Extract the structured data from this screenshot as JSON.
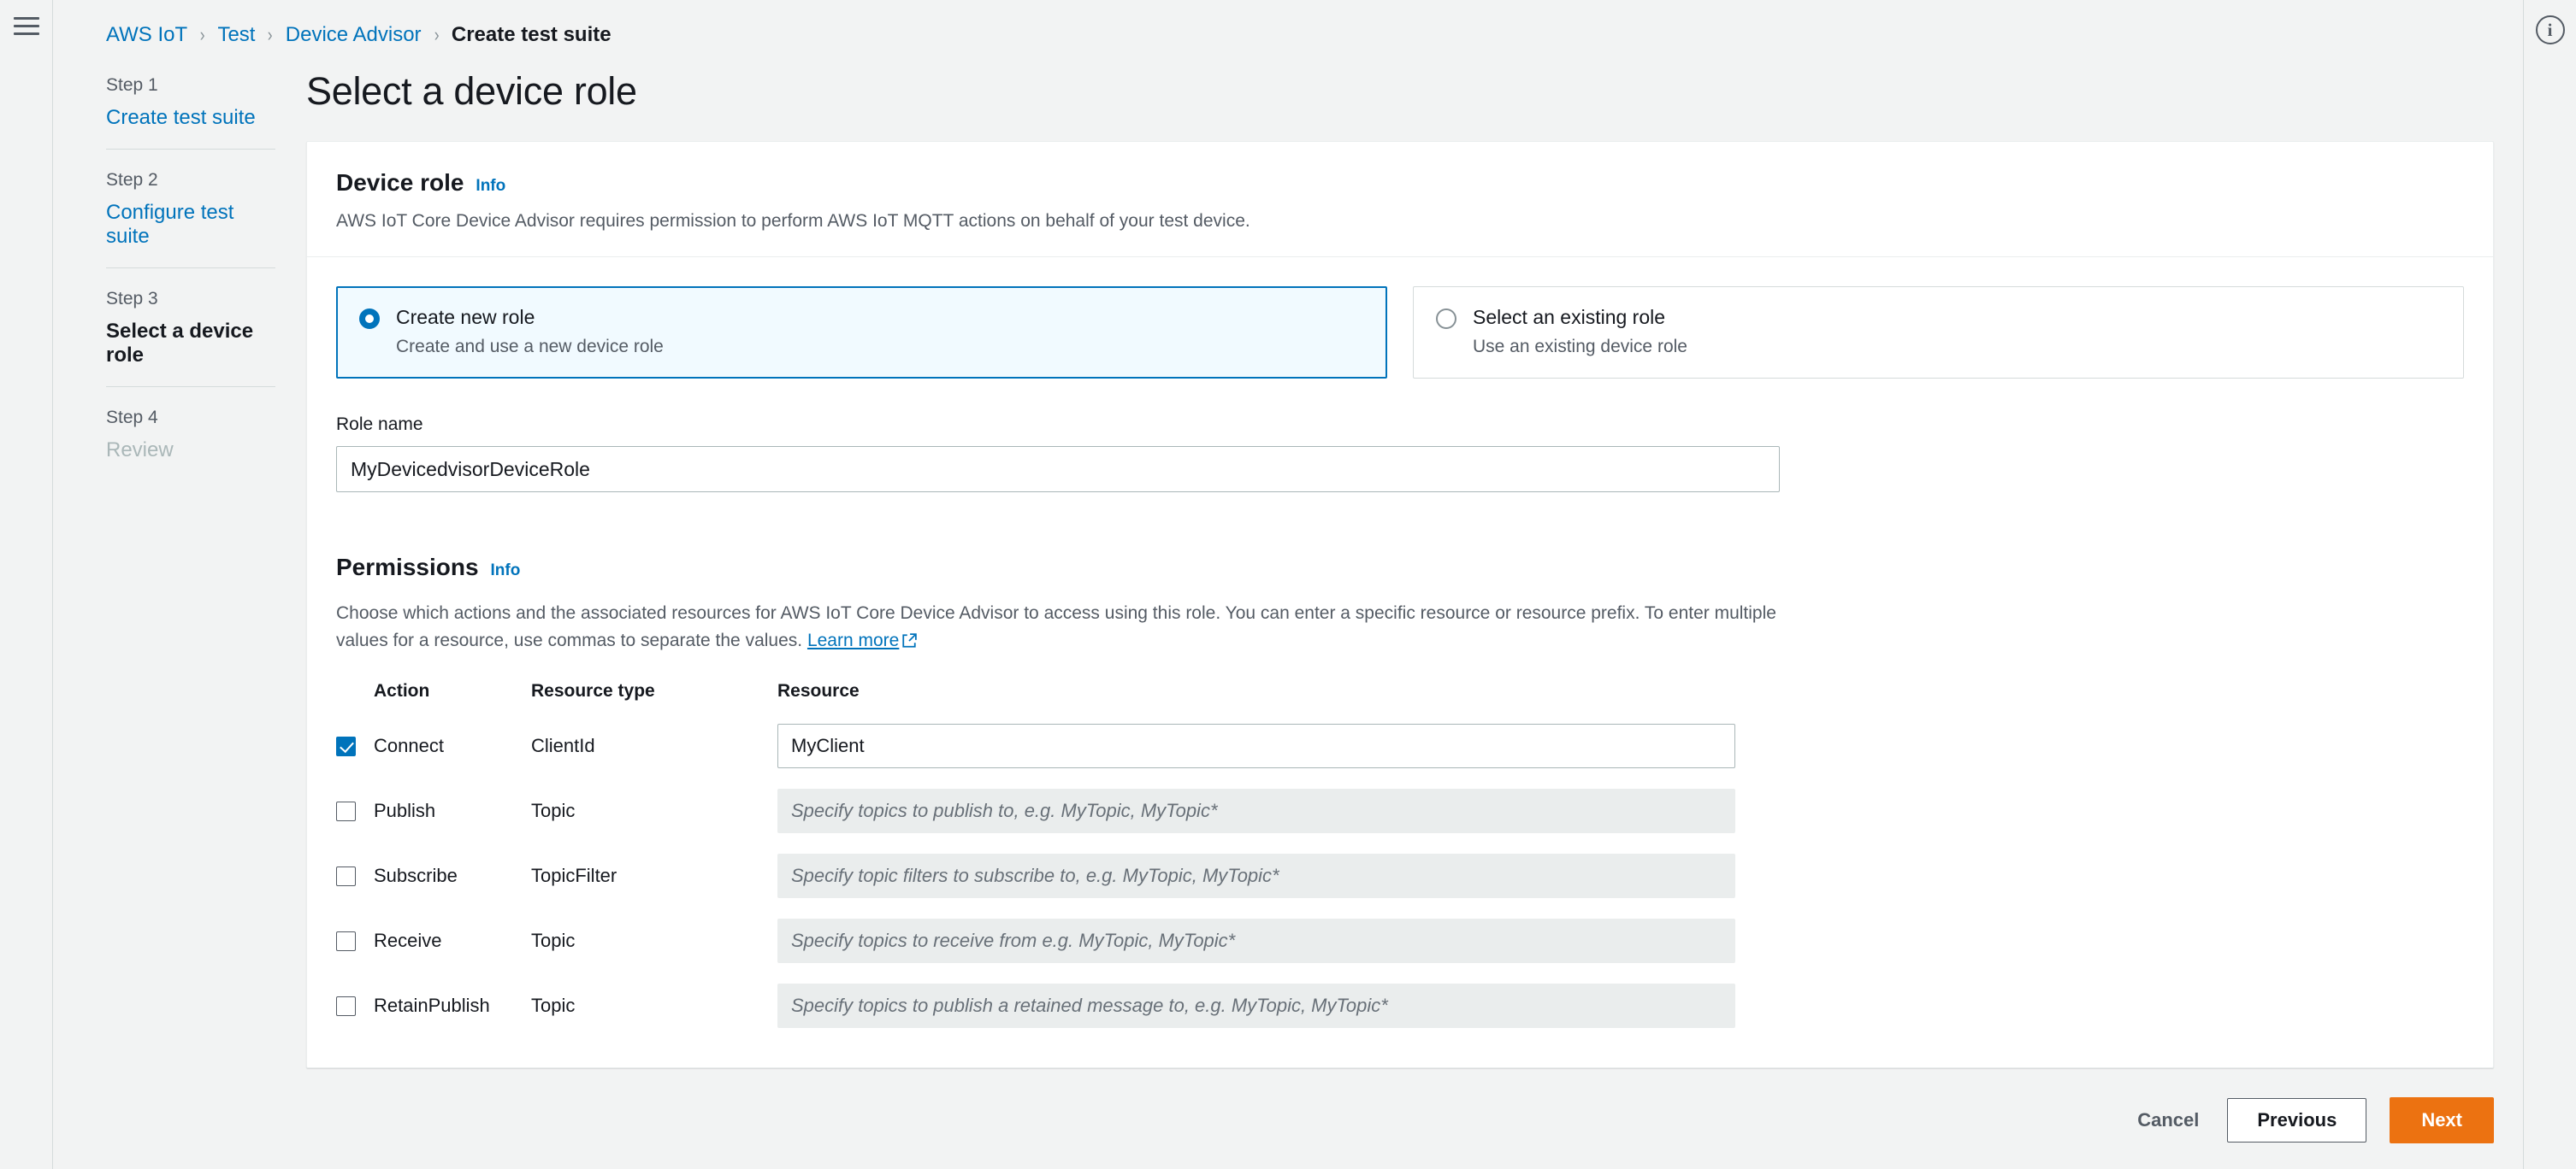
{
  "breadcrumb": [
    {
      "label": "AWS IoT",
      "current": false
    },
    {
      "label": "Test",
      "current": false
    },
    {
      "label": "Device Advisor",
      "current": false
    },
    {
      "label": "Create test suite",
      "current": true
    }
  ],
  "separator": "›",
  "steps": [
    {
      "number": "Step 1",
      "name": "Create test suite",
      "state": "link"
    },
    {
      "number": "Step 2",
      "name": "Configure test suite",
      "state": "link"
    },
    {
      "number": "Step 3",
      "name": "Select a device role",
      "state": "active"
    },
    {
      "number": "Step 4",
      "name": "Review",
      "state": "disabled"
    }
  ],
  "page": {
    "title": "Select a device role"
  },
  "device_role": {
    "title": "Device role",
    "info_label": "Info",
    "description": "AWS IoT Core Device Advisor requires permission to perform AWS IoT MQTT actions on behalf of your test device.",
    "options": [
      {
        "label": "Create new role",
        "sublabel": "Create and use a new device role",
        "selected": true
      },
      {
        "label": "Select an existing role",
        "sublabel": "Use an existing device role",
        "selected": false
      }
    ],
    "role_name_label": "Role name",
    "role_name_value": "MyDevicedvisorDeviceRole"
  },
  "permissions": {
    "title": "Permissions",
    "info_label": "Info",
    "description": "Choose which actions and the associated resources for AWS IoT Core Device Advisor to access using this role. You can enter a specific resource or resource prefix. To enter multiple values for a resource, use commas to separate the values.",
    "learn_more": "Learn more",
    "columns": [
      "Action",
      "Resource type",
      "Resource"
    ],
    "rows": [
      {
        "action": "Connect",
        "resource_type": "ClientId",
        "checked": true,
        "value": "MyClient",
        "placeholder": ""
      },
      {
        "action": "Publish",
        "resource_type": "Topic",
        "checked": false,
        "value": "",
        "placeholder": "Specify topics to publish to, e.g. MyTopic, MyTopic*"
      },
      {
        "action": "Subscribe",
        "resource_type": "TopicFilter",
        "checked": false,
        "value": "",
        "placeholder": "Specify topic filters to subscribe to, e.g. MyTopic, MyTopic*"
      },
      {
        "action": "Receive",
        "resource_type": "Topic",
        "checked": false,
        "value": "",
        "placeholder": "Specify topics to receive from e.g. MyTopic, MyTopic*"
      },
      {
        "action": "RetainPublish",
        "resource_type": "Topic",
        "checked": false,
        "value": "",
        "placeholder": "Specify topics to publish a retained message to, e.g. MyTopic, MyTopic*"
      }
    ]
  },
  "footer": {
    "cancel": "Cancel",
    "previous": "Previous",
    "next": "Next"
  },
  "icons": {
    "menu": "hamburger-menu-icon",
    "info": "info-circle-icon",
    "external": "external-link-icon"
  },
  "colors": {
    "link": "#0073bb",
    "primary_button": "#ec7211",
    "selected_card_bg": "#f1faff",
    "page_bg": "#f2f3f3"
  }
}
